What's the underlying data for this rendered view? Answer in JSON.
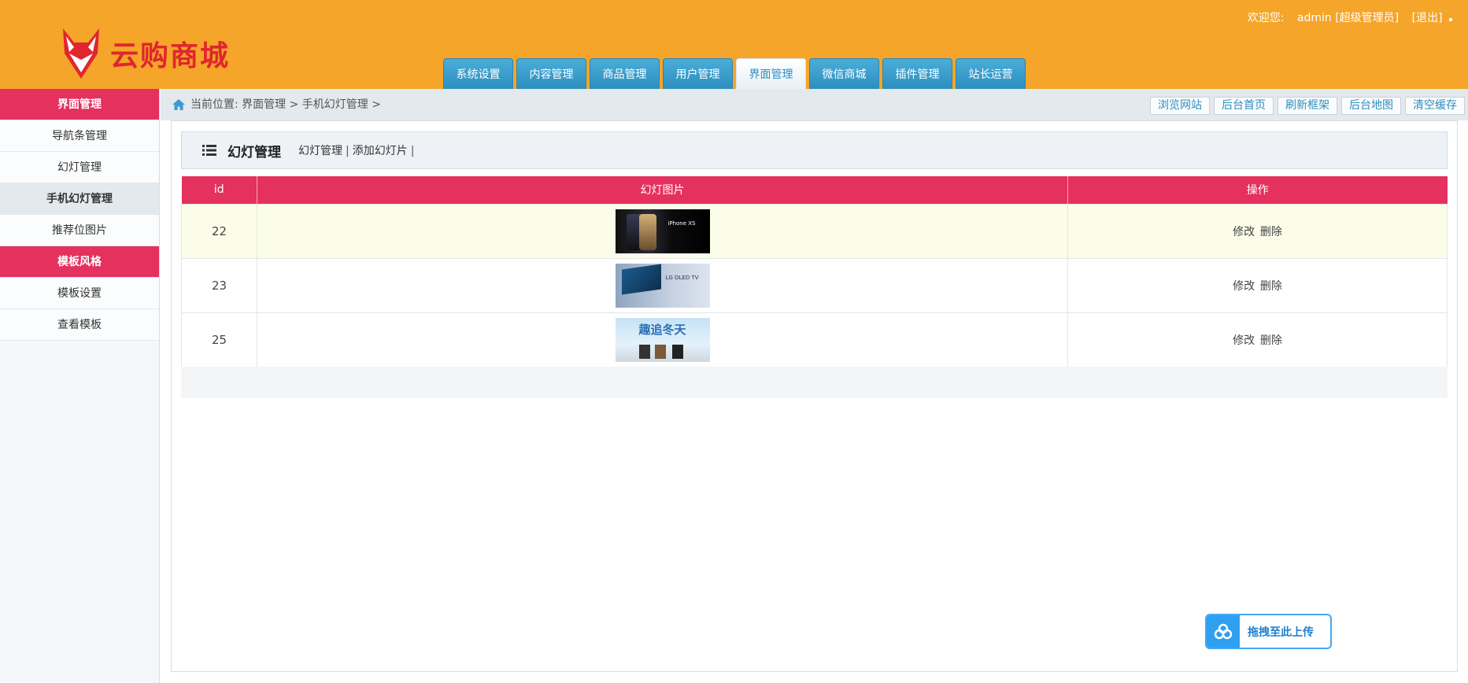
{
  "header": {
    "logo_text": "云购商城",
    "welcome": "欢迎您:",
    "user": "admin [超级管理员]",
    "logout": "[退出]"
  },
  "topnav": {
    "tabs": [
      {
        "label": "系统设置"
      },
      {
        "label": "内容管理"
      },
      {
        "label": "商品管理"
      },
      {
        "label": "用户管理"
      },
      {
        "label": "界面管理"
      },
      {
        "label": "微信商城"
      },
      {
        "label": "插件管理"
      },
      {
        "label": "站长运营"
      }
    ]
  },
  "sidebar": {
    "items": [
      {
        "label": "界面管理"
      },
      {
        "label": "导航条管理"
      },
      {
        "label": "幻灯管理"
      },
      {
        "label": "手机幻灯管理"
      },
      {
        "label": "推荐位图片"
      },
      {
        "label": "模板风格"
      },
      {
        "label": "模板设置"
      },
      {
        "label": "查看模板"
      }
    ]
  },
  "breadcrumb": {
    "text": "当前位置: 界面管理 > 手机幻灯管理 >"
  },
  "toolbar": {
    "buttons": [
      {
        "label": "浏览网站"
      },
      {
        "label": "后台首页"
      },
      {
        "label": "刷新框架"
      },
      {
        "label": "后台地图"
      },
      {
        "label": "清空缓存"
      }
    ]
  },
  "panel": {
    "title": "幻灯管理",
    "link_manage": "幻灯管理",
    "link_add": "添加幻灯片",
    "sep": "|"
  },
  "table": {
    "headers": [
      "id",
      "幻灯图片",
      "操作"
    ],
    "rows": [
      {
        "id": "22",
        "image_text": "iPhone XS",
        "edit": "修改",
        "delete": "删除"
      },
      {
        "id": "23",
        "image_text": "LG OLED TV",
        "edit": "修改",
        "delete": "删除"
      },
      {
        "id": "25",
        "image_text": "趣追冬天",
        "edit": "修改",
        "delete": "删除"
      }
    ]
  },
  "upload": {
    "label": "拖拽至此上传"
  },
  "colors": {
    "header_bg": "#f5a529",
    "accent_red": "#e5315d",
    "tab_blue": "#2d8ec0",
    "logo_red": "#e0262f"
  }
}
